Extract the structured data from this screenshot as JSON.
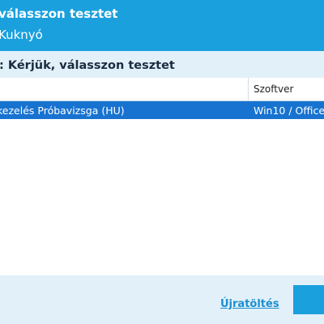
{
  "header": {
    "title": "válasszon tesztet",
    "subtitle": "Kuknyó"
  },
  "section": {
    "title": ": Kérjük, válasszon tesztet"
  },
  "table": {
    "columns": [
      "Szoftver"
    ],
    "rows": [
      {
        "test": "kezelés Próbavizsga (HU)",
        "software": "Win10 / Office",
        "selected": true
      }
    ]
  },
  "footer": {
    "reload_label": "Újratöltés"
  },
  "colors": {
    "header_bg": "#1aa0dd",
    "section_bg": "#e2f0fa",
    "selected_row": "#1873d0",
    "link": "#1a8fd0"
  }
}
